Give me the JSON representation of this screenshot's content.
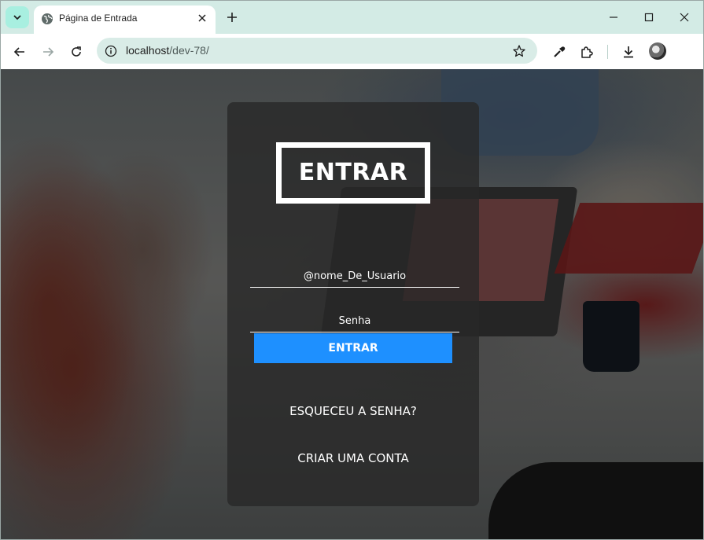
{
  "browser": {
    "tab_title": "Página de Entrada",
    "url_host": "localhost",
    "url_path": "/dev-78/"
  },
  "icons": {
    "tab_search": "chevron-down-icon",
    "favicon": "globe-icon",
    "tab_close": "close-icon",
    "new_tab": "plus-icon",
    "minimize": "minimize-icon",
    "maximize": "maximize-icon",
    "window_close": "close-icon",
    "back": "arrow-left-icon",
    "forward": "arrow-right-icon",
    "reload": "reload-icon",
    "site_info": "info-icon",
    "bookmark": "star-icon",
    "eyedropper": "eyedropper-icon",
    "extensions": "puzzle-icon",
    "downloads": "download-icon",
    "profile": "avatar-icon"
  },
  "login": {
    "title": "ENTRAR",
    "username_placeholder": "@nome_De_Usuario",
    "password_placeholder": "Senha",
    "submit_label": "ENTRAR",
    "forgot_password": "ESQUECEU A SENHA?",
    "create_account": "CRIAR UMA CONTA"
  },
  "colors": {
    "accent": "#1e90ff",
    "browser_frame": "#d3ebe5",
    "card_background": "rgba(40,40,40,0.80)"
  }
}
